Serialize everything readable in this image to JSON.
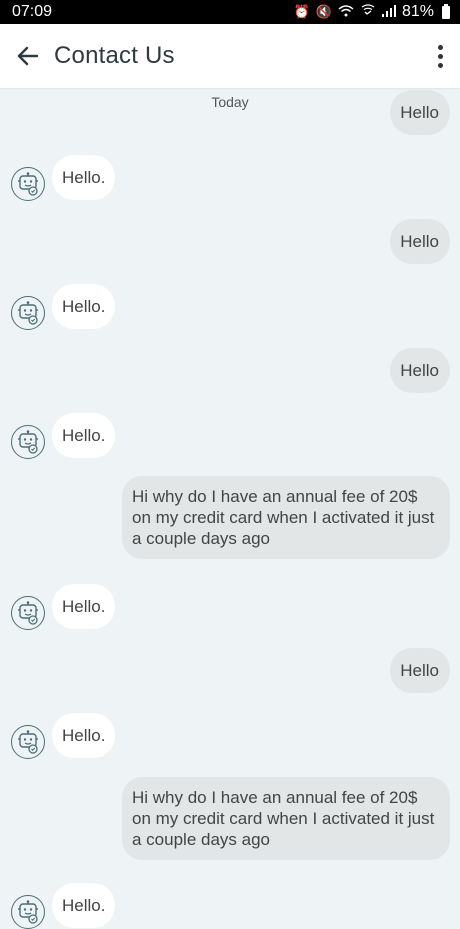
{
  "status": {
    "time": "07:09",
    "battery": "81%",
    "icons": [
      "alarm-icon",
      "mute-icon",
      "wifi-icon",
      "wifi-call-icon",
      "signal-icon",
      "battery-icon"
    ]
  },
  "header": {
    "title": "Contact Us",
    "icons": [
      "back-arrow-icon",
      "more-vert-icon"
    ]
  },
  "chat": {
    "date_label": "Today",
    "colors": {
      "user_bubble": "#e3e6e6",
      "bot_bubble": "#ffffff",
      "background": "#eef4f5"
    },
    "messages": [
      {
        "sender": "user",
        "text": "Hello"
      },
      {
        "sender": "bot",
        "text": "Hello."
      },
      {
        "sender": "user",
        "text": "Hello"
      },
      {
        "sender": "bot",
        "text": "Hello."
      },
      {
        "sender": "user",
        "text": "Hello"
      },
      {
        "sender": "bot",
        "text": "Hello."
      },
      {
        "sender": "user",
        "text": "Hi why do I have an annual fee of 20$ on my credit card when I activated it just a couple days ago"
      },
      {
        "sender": "bot",
        "text": "Hello."
      },
      {
        "sender": "user",
        "text": "Hello"
      },
      {
        "sender": "bot",
        "text": "Hello."
      },
      {
        "sender": "user",
        "text": "Hi why do I have an annual fee of 20$ on my credit card when I activated it just a couple days ago"
      },
      {
        "sender": "bot",
        "text": "Hello."
      }
    ]
  }
}
